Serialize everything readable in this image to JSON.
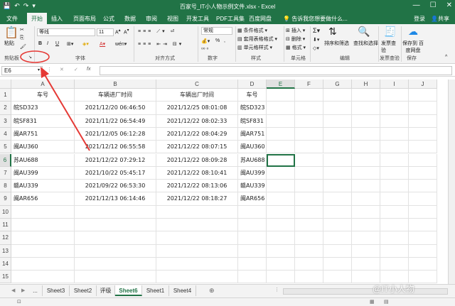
{
  "window": {
    "title": "百家号_IT小人物示例文件.xlsx - Excel",
    "controls": [
      "—",
      "☐",
      "✕"
    ]
  },
  "qat": [
    "💾",
    "↶",
    "↷",
    "▾"
  ],
  "ribbon_tabs": [
    "文件",
    "开始",
    "插入",
    "页面布局",
    "公式",
    "数据",
    "审阅",
    "视图",
    "开发工具",
    "PDF工具集",
    "百度网盘"
  ],
  "tell_me": "告诉我您想要做什么...",
  "login": "登录",
  "share": "共享",
  "ribbon": {
    "clipboard": {
      "paste": "粘贴",
      "label": "剪贴板"
    },
    "font": {
      "name": "等线",
      "size": "11",
      "label": "字体",
      "bold": "B",
      "italic": "I",
      "underline": "U"
    },
    "alignment": {
      "label": "对齐方式"
    },
    "number": {
      "format": "常规",
      "label": "数字",
      "percent": "%"
    },
    "styles": {
      "items": [
        "条件格式 ▾",
        "套用表格格式 ▾",
        "单元格样式 ▾"
      ],
      "label": "样式"
    },
    "cells": {
      "items": [
        "插入 ▾",
        "删除 ▾",
        "格式 ▾"
      ],
      "label": "单元格"
    },
    "editing": {
      "sort": "排序和筛选",
      "find": "查找和选择",
      "label": "编辑"
    },
    "invoice": {
      "btn": "发票查验",
      "label": "发票查验"
    },
    "save": {
      "btn": "保存到 百度网盘",
      "label": "保存"
    }
  },
  "formula_bar": {
    "name_box": "E6",
    "fx": "fx",
    "value": ""
  },
  "columns": [
    "A",
    "B",
    "C",
    "D",
    "E",
    "F",
    "G",
    "H",
    "I",
    "J"
  ],
  "selected_col": "E",
  "selected_row": 6,
  "rows": [
    "1",
    "2",
    "3",
    "4",
    "5",
    "6",
    "7",
    "8",
    "9",
    "10",
    "11",
    "12",
    "13",
    "14",
    "15"
  ],
  "table": {
    "headers": [
      "车号",
      "车辆进厂时间",
      "车辆出厂时间",
      "车号"
    ],
    "rows": [
      [
        "皖SD323",
        "2021/12/20  06:46:50",
        "2021/12/25  08:01:08",
        "皖SD323"
      ],
      [
        "皖SF831",
        "2021/11/22  06:54:49",
        "2021/12/22  08:02:33",
        "皖SF831"
      ],
      [
        "闽AR751",
        "2021/12/05  06:12:28",
        "2021/12/22  08:04:29",
        "闽AR751"
      ],
      [
        "闽AU360",
        "2021/12/12  06:55:58",
        "2021/12/22  08:07:15",
        "闽AU360"
      ],
      [
        "苏AU688",
        "2021/12/22  07:29:12",
        "2021/12/22  08:09:28",
        "苏AU688"
      ],
      [
        "闽AU399",
        "2021/10/22  05:45:17",
        "2021/12/22  08:10:41",
        "闽AU399"
      ],
      [
        "赣AU339",
        "2021/09/22  06:53:30",
        "2021/12/22  08:13:06",
        "赣AU339"
      ],
      [
        "闽AR656",
        "2021/12/13  06:14:46",
        "2021/12/22  08:18:27",
        "闽AR656"
      ]
    ]
  },
  "sheets": [
    "...",
    "Sheet3",
    "Sheet2",
    "评级",
    "Sheet6",
    "Sheet1",
    "Sheet4"
  ],
  "active_sheet": "Sheet6",
  "watermark": "@IT小人物",
  "colors": {
    "excel_green": "#217346",
    "annotation_red": "#e53935"
  }
}
